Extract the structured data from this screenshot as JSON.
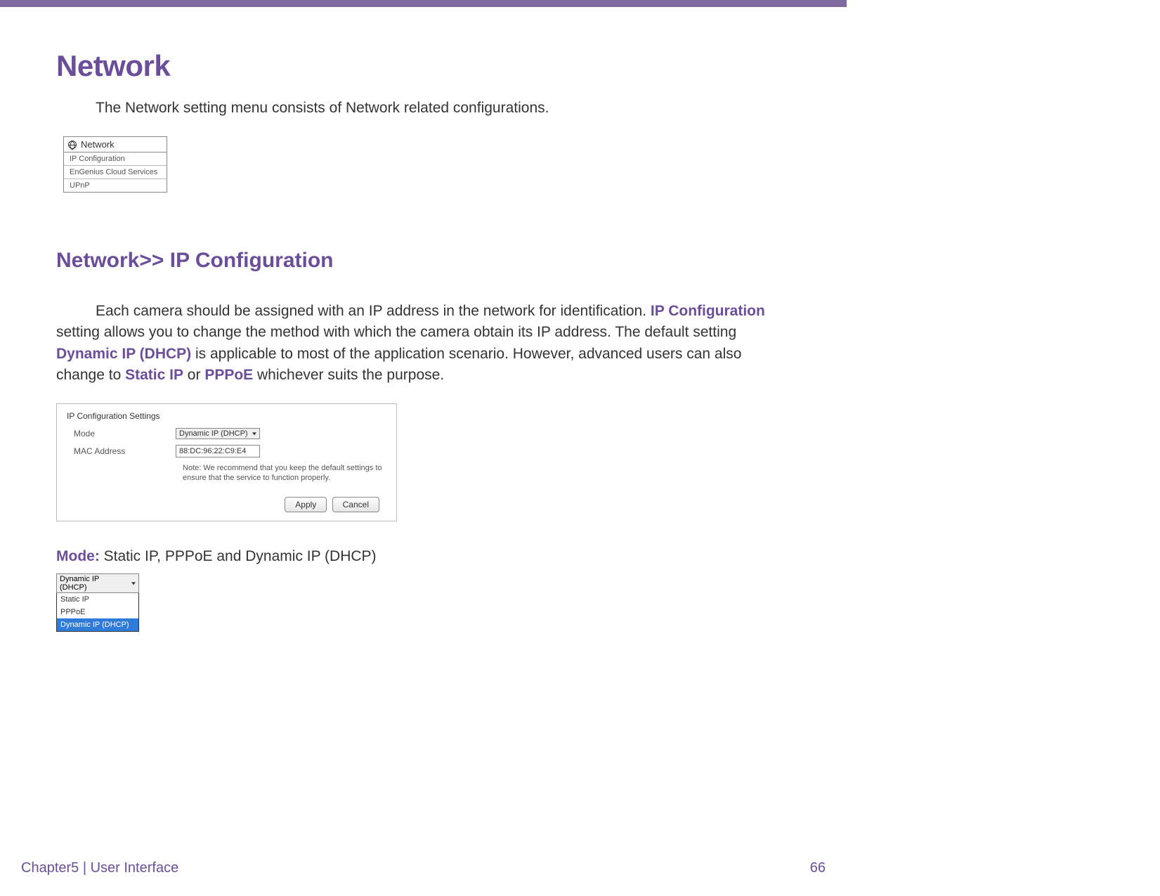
{
  "header": {
    "title": "Network"
  },
  "intro": "The Network setting menu consists of Network related configurations.",
  "sidebar_menu": {
    "title": "Network",
    "items": [
      "IP Configuration",
      "EnGenius Cloud Services",
      "UPnP"
    ]
  },
  "subtitle": "Network>> IP Configuration",
  "paragraph": {
    "t1": "Each camera should be assigned with an IP address in the network for identification. ",
    "hl1": "IP Configuration",
    "t2": " setting allows you to change the method with which the camera obtain its IP address. The default setting ",
    "hl2": "Dynamic IP (DHCP)",
    "t3": " is applicable to most of the application scenario. However, advanced users can also change to ",
    "hl3": "Static IP",
    "t4": " or ",
    "hl4": "PPPoE",
    "t5": " whichever suits the purpose."
  },
  "settings_panel": {
    "title": "IP Configuration Settings",
    "mode_label": "Mode",
    "mode_value": "Dynamic IP (DHCP)",
    "mac_label": "MAC Address",
    "mac_value": "88:DC:96:22:C9:E4",
    "note": "Note: We recommend that you keep the default settings to ensure that the service to function properly.",
    "apply": "Apply",
    "cancel": "Cancel"
  },
  "mode_line": {
    "label": "Mode:",
    "text": " Static IP, PPPoE and Dynamic IP (DHCP)"
  },
  "dropdown": {
    "selected": "Dynamic IP (DHCP)",
    "options": [
      "Static IP",
      "PPPoE",
      "Dynamic IP (DHCP)"
    ],
    "highlighted_index": 2
  },
  "footer": {
    "left": "Chapter5  |  User Interface",
    "page": "66"
  }
}
